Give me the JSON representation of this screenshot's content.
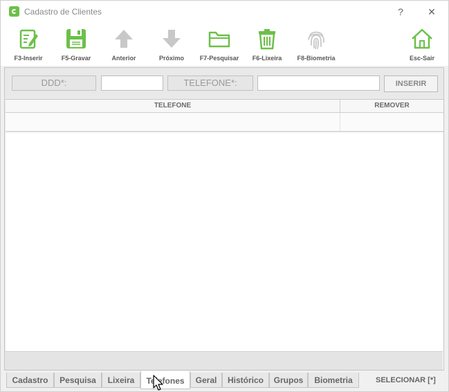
{
  "window": {
    "title": "Cadastro de Clientes",
    "help_glyph": "?",
    "close_glyph": "✕"
  },
  "toolbar": {
    "items": [
      {
        "label": "F3-Inserir",
        "icon": "edit-document-icon",
        "enabled": true
      },
      {
        "label": "F5-Gravar",
        "icon": "save-floppy-icon",
        "enabled": true
      },
      {
        "label": "Anterior",
        "icon": "arrow-up-icon",
        "enabled": false
      },
      {
        "label": "Próximo",
        "icon": "arrow-down-icon",
        "enabled": false
      },
      {
        "label": "F7-Pesquisar",
        "icon": "folder-icon",
        "enabled": true
      },
      {
        "label": "F6-Lixeira",
        "icon": "trash-icon",
        "enabled": true
      },
      {
        "label": "F8-Biometria",
        "icon": "fingerprint-icon",
        "enabled": false
      },
      {
        "label": "Esc-Sair",
        "icon": "home-icon",
        "enabled": true
      }
    ]
  },
  "form": {
    "ddd_label": "DDD*:",
    "ddd_value": "",
    "telefone_label": "TELEFONE*:",
    "telefone_value": "",
    "insert_button": "INSERIR"
  },
  "grid": {
    "columns": [
      "TELEFONE",
      "REMOVER"
    ],
    "rows": [
      [
        "",
        ""
      ]
    ]
  },
  "tabs": {
    "items": [
      "Cadastro",
      "Pesquisa",
      "Lixeira",
      "Telefones",
      "Geral",
      "Histórico",
      "Grupos",
      "Biometria"
    ],
    "active": "Telefones"
  },
  "footer": {
    "select_label": "SELECIONAR [*]"
  },
  "colors": {
    "accent_green": "#6cc04a",
    "disabled_gray": "#c8c8c8"
  }
}
